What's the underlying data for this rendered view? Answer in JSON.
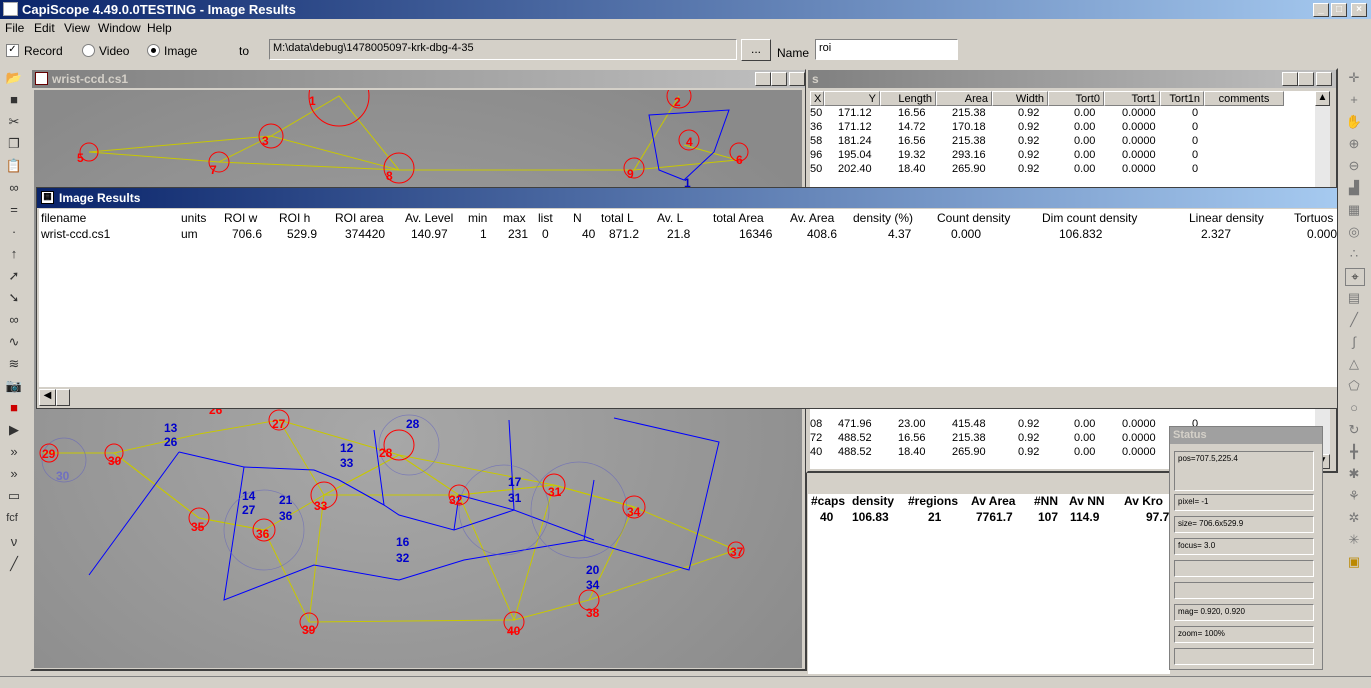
{
  "app": {
    "title": "CapiScope 4.49.0.0TESTING - Image Results"
  },
  "menu": [
    "File",
    "Edit",
    "View",
    "Window",
    "Help"
  ],
  "options": {
    "record": "Record",
    "video": "Video",
    "image": "Image",
    "to": "to",
    "path": "M:\\data\\debug\\1478005097-krk-dbg-4-35",
    "browse": "...",
    "name_label": "Name",
    "name_value": "roi"
  },
  "image_window": {
    "title": "wrist-ccd.cs1"
  },
  "table_window": {
    "title": "s",
    "headers": [
      "X",
      "Y",
      "Length",
      "Area",
      "Width",
      "Tort0",
      "Tort1",
      "Tort1n",
      "comments"
    ],
    "rows_top": [
      [
        "50",
        "171.12",
        "16.56",
        "215.38",
        "0.92",
        "0.00",
        "0.0000",
        "0"
      ],
      [
        "36",
        "171.12",
        "14.72",
        "170.18",
        "0.92",
        "0.00",
        "0.0000",
        "0"
      ],
      [
        "58",
        "181.24",
        "16.56",
        "215.38",
        "0.92",
        "0.00",
        "0.0000",
        "0"
      ],
      [
        "96",
        "195.04",
        "19.32",
        "293.16",
        "0.92",
        "0.00",
        "0.0000",
        "0"
      ],
      [
        "50",
        "202.40",
        "18.40",
        "265.90",
        "0.92",
        "0.00",
        "0.0000",
        "0"
      ]
    ],
    "rows_bottom": [
      [
        "08",
        "471.96",
        "23.00",
        "415.48",
        "0.92",
        "0.00",
        "0.0000",
        "0"
      ],
      [
        "72",
        "488.52",
        "16.56",
        "215.38",
        "0.92",
        "0.00",
        "0.0000",
        "0"
      ],
      [
        "40",
        "488.52",
        "18.40",
        "265.90",
        "0.92",
        "0.00",
        "0.0000",
        "0"
      ]
    ]
  },
  "summary": {
    "headers": [
      "#caps",
      "density",
      "#regions",
      "Av Area",
      "#NN",
      "Av NN",
      "Av Kro"
    ],
    "values": [
      "40",
      "106.83",
      "21",
      "7761.7",
      "107",
      "114.9",
      "97.7"
    ]
  },
  "results": {
    "title": "Image Results",
    "headers": [
      "filename",
      "units",
      "ROI w",
      "ROI h",
      "ROI area",
      "Av. Level",
      "min",
      "max",
      "list",
      "N",
      "total L",
      "Av. L",
      "total Area",
      "Av. Area",
      "density (%)",
      "Count density",
      "Dim count density",
      "Linear density",
      "Tortuos"
    ],
    "values": [
      "wrist-ccd.cs1",
      "um",
      "706.6",
      "529.9",
      "374420",
      "140.97",
      "1",
      "231",
      "0",
      "40",
      "871.2",
      "21.8",
      "16346",
      "408.6",
      "4.37",
      "0.000",
      "106.832",
      "2.327",
      "0.000"
    ]
  },
  "status": {
    "title": "Status",
    "fields": [
      "pos=707.5,225.4",
      "",
      "pixel= -1",
      "size= 706.6x529.9",
      "focus=  3.0",
      "",
      "",
      "mag= 0.920, 0.920",
      "zoom= 100%",
      ""
    ]
  },
  "markers_red": [
    "1",
    "2",
    "3",
    "4",
    "5",
    "6",
    "7",
    "8",
    "9",
    "27",
    "26",
    "28",
    "29",
    "30",
    "31",
    "32",
    "33",
    "34",
    "35",
    "36",
    "37",
    "38",
    "39",
    "40"
  ],
  "markers_blue": [
    "1",
    "13",
    "26",
    "12",
    "33",
    "14",
    "27",
    "21",
    "36",
    "28",
    "17",
    "31",
    "16",
    "32",
    "20",
    "34",
    "30"
  ],
  "colors": {
    "active_title": "#0a246a",
    "inactive_title": "#808080",
    "cap_marker": "#ff0000",
    "region": "#0000ff",
    "network": "#c8c800"
  }
}
